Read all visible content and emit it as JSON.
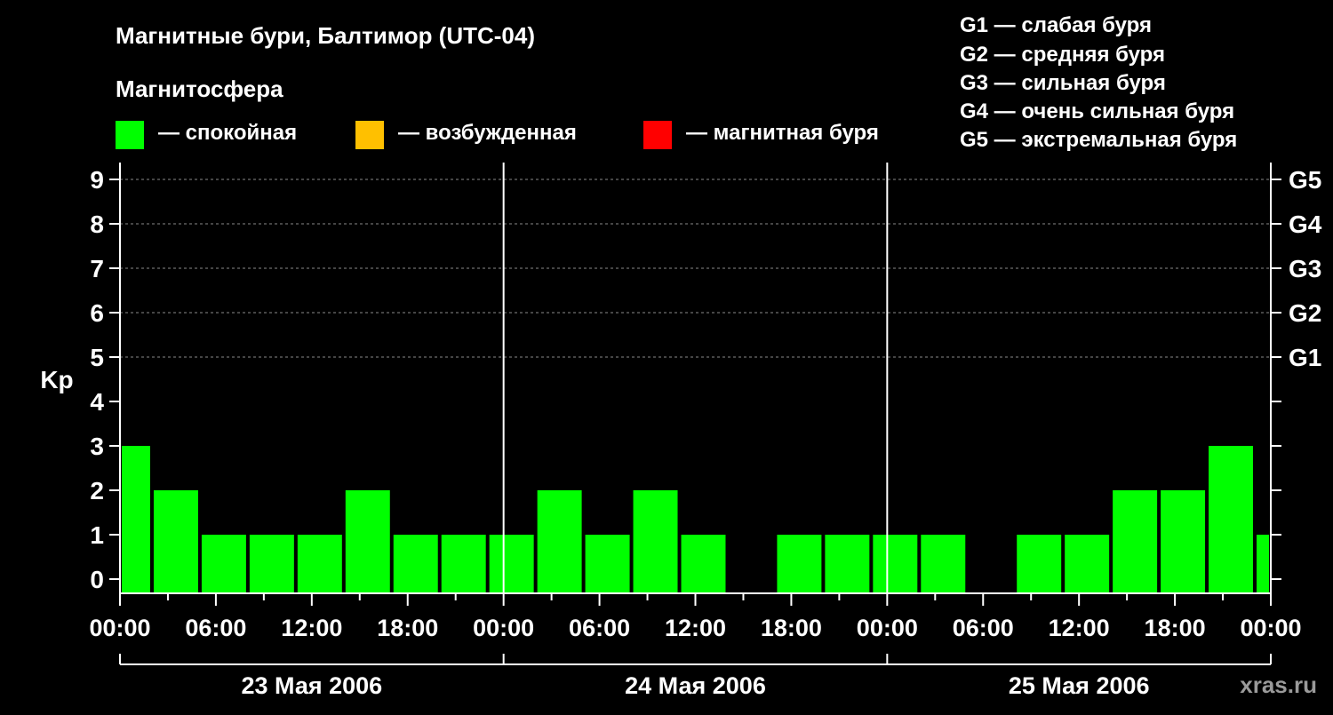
{
  "title": "Магнитные бури, Балтимор (UTC-04)",
  "legend": {
    "heading": "Магнитосфера",
    "items": [
      {
        "label": "— спокойная",
        "color": "#00ff00"
      },
      {
        "label": "— возбужденная",
        "color": "#ffc000"
      },
      {
        "label": "— магнитная буря",
        "color": "#ff0000"
      }
    ]
  },
  "g_scale": [
    "G1 — слабая буря",
    "G2 — средняя буря",
    "G3 — сильная буря",
    "G4 — очень сильная буря",
    "G5 — экстремальная буря"
  ],
  "watermark": "xras.ru",
  "chart_data": {
    "type": "bar",
    "ylabel": "Kp",
    "ylim": [
      0,
      9
    ],
    "y_ticks": [
      "0",
      "1",
      "2",
      "3",
      "4",
      "5",
      "6",
      "7",
      "8",
      "9"
    ],
    "right_ticks": [
      {
        "kp": 5,
        "label": "G1"
      },
      {
        "kp": 6,
        "label": "G2"
      },
      {
        "kp": 7,
        "label": "G3"
      },
      {
        "kp": 8,
        "label": "G4"
      },
      {
        "kp": 9,
        "label": "G5"
      }
    ],
    "x_tick_labels": [
      "00:00",
      "06:00",
      "12:00",
      "18:00",
      "00:00",
      "06:00",
      "12:00",
      "18:00",
      "00:00",
      "06:00",
      "12:00",
      "18:00",
      "00:00"
    ],
    "days": [
      "23 Мая 2006",
      "24 Мая 2006",
      "25 Мая 2006"
    ],
    "grid": "dashed horizontal lines at Kp 5–9",
    "bars": [
      {
        "start_h": 0,
        "end_h": 2,
        "kp": 3
      },
      {
        "start_h": 2,
        "end_h": 5,
        "kp": 2
      },
      {
        "start_h": 5,
        "end_h": 8,
        "kp": 1
      },
      {
        "start_h": 8,
        "end_h": 11,
        "kp": 1
      },
      {
        "start_h": 11,
        "end_h": 14,
        "kp": 1
      },
      {
        "start_h": 14,
        "end_h": 17,
        "kp": 2
      },
      {
        "start_h": 17,
        "end_h": 20,
        "kp": 1
      },
      {
        "start_h": 20,
        "end_h": 23,
        "kp": 1
      },
      {
        "start_h": 23,
        "end_h": 26,
        "kp": 1
      },
      {
        "start_h": 26,
        "end_h": 29,
        "kp": 2
      },
      {
        "start_h": 29,
        "end_h": 32,
        "kp": 1
      },
      {
        "start_h": 32,
        "end_h": 35,
        "kp": 2
      },
      {
        "start_h": 35,
        "end_h": 38,
        "kp": 1
      },
      {
        "start_h": 38,
        "end_h": 41,
        "kp": 0
      },
      {
        "start_h": 41,
        "end_h": 44,
        "kp": 1
      },
      {
        "start_h": 44,
        "end_h": 47,
        "kp": 1
      },
      {
        "start_h": 47,
        "end_h": 50,
        "kp": 1
      },
      {
        "start_h": 50,
        "end_h": 53,
        "kp": 1
      },
      {
        "start_h": 53,
        "end_h": 56,
        "kp": 0
      },
      {
        "start_h": 56,
        "end_h": 59,
        "kp": 1
      },
      {
        "start_h": 59,
        "end_h": 62,
        "kp": 1
      },
      {
        "start_h": 62,
        "end_h": 65,
        "kp": 2
      },
      {
        "start_h": 65,
        "end_h": 68,
        "kp": 2
      },
      {
        "start_h": 68,
        "end_h": 71,
        "kp": 3
      },
      {
        "start_h": 71,
        "end_h": 72,
        "kp": 1
      }
    ]
  }
}
